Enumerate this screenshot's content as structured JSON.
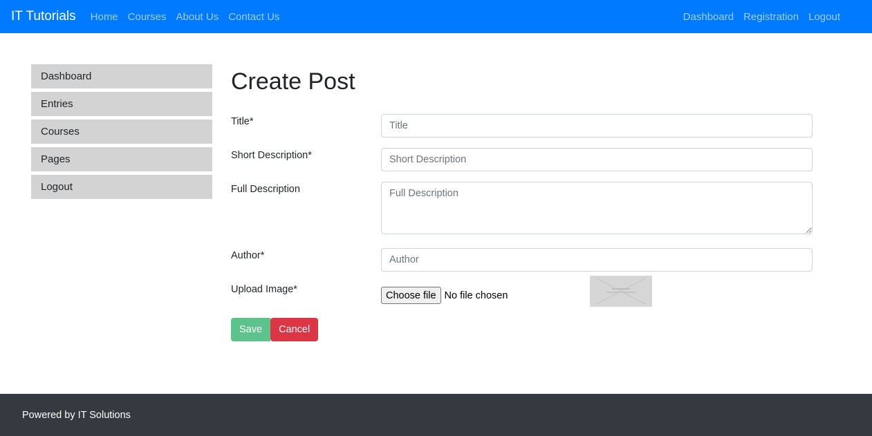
{
  "navbar": {
    "brand": "IT Tutorials",
    "left_links": [
      "Home",
      "Courses",
      "About Us",
      "Contact Us"
    ],
    "right_links": [
      "Dashboard",
      "Registration",
      "Logout"
    ],
    "background_color": "#007bff"
  },
  "sidebar": {
    "items": [
      {
        "label": "Dashboard"
      },
      {
        "label": "Entries"
      },
      {
        "label": "Courses"
      },
      {
        "label": "Pages"
      },
      {
        "label": "Logout"
      }
    ]
  },
  "form": {
    "title": "Create Post",
    "fields": {
      "title": {
        "label": "Title*",
        "placeholder": "Title",
        "value": ""
      },
      "short_description": {
        "label": "Short Description*",
        "placeholder": "Short Description",
        "value": ""
      },
      "full_description": {
        "label": "Full Description",
        "placeholder": "Full Description",
        "value": ""
      },
      "author": {
        "label": "Author*",
        "placeholder": "Author",
        "value": ""
      },
      "upload_image": {
        "label": "Upload Image*",
        "button_label": "Choose file",
        "status": "No file chosen"
      }
    },
    "save_label": "Save",
    "cancel_label": "Cancel",
    "save_color": "#5cc38c",
    "cancel_color": "#dc3545"
  },
  "footer": {
    "text": "Powered by IT Solutions",
    "background_color": "#343a40"
  }
}
